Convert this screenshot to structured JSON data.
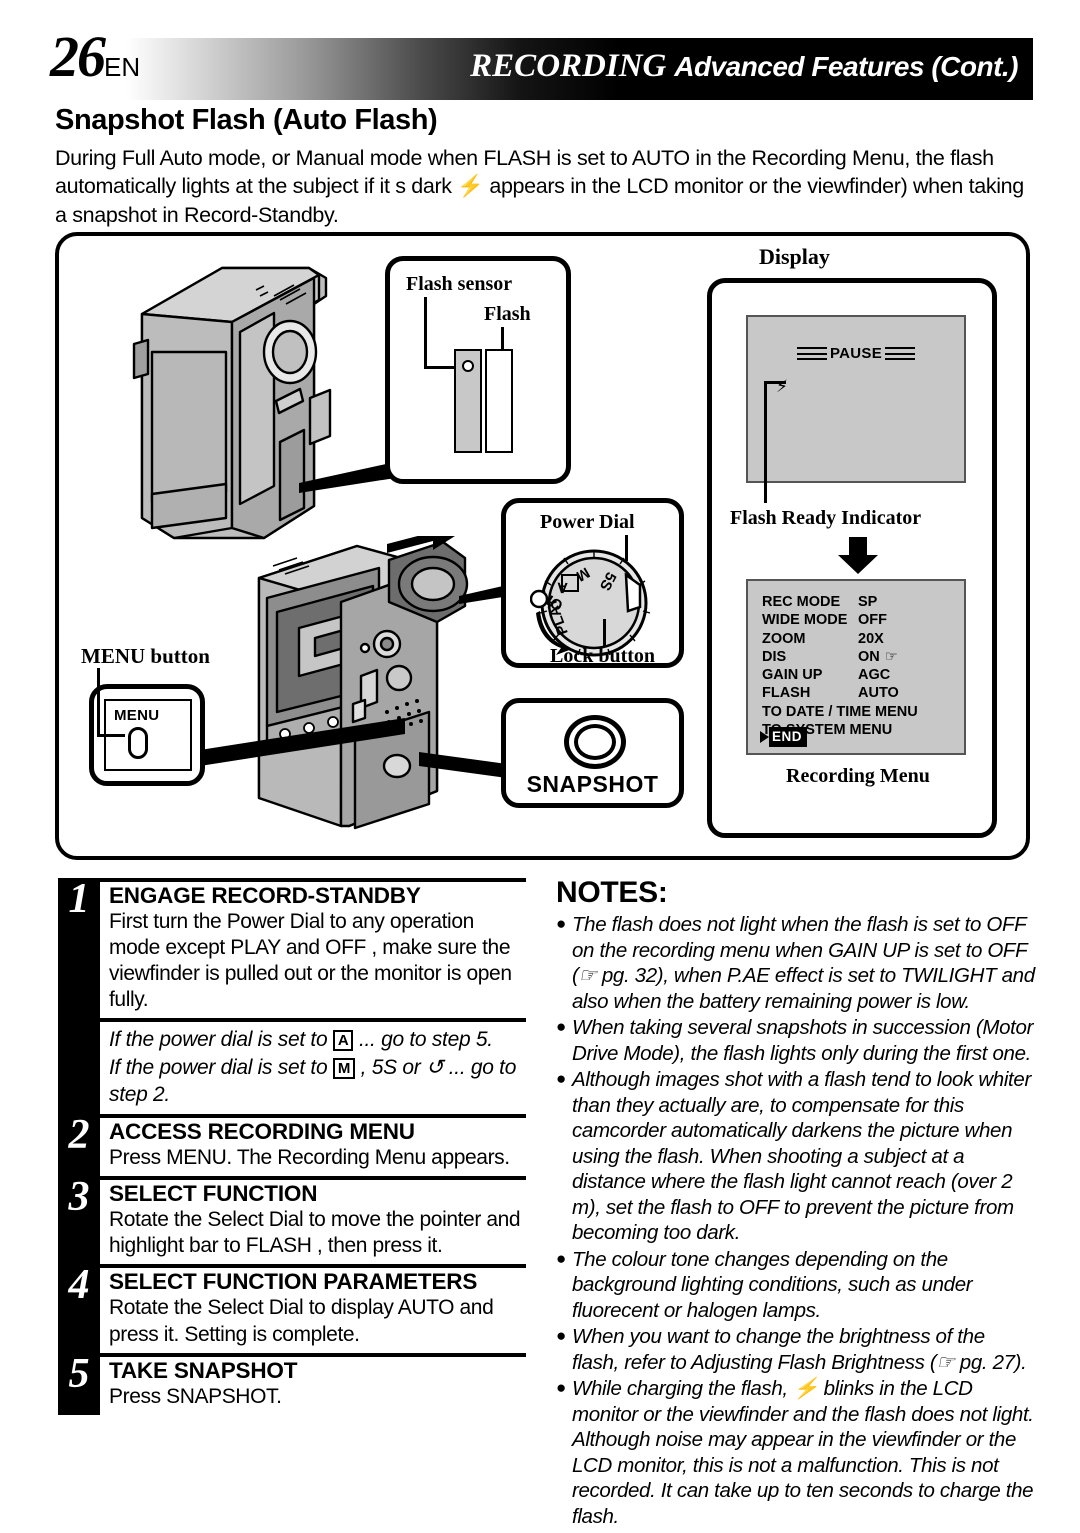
{
  "header": {
    "page_number": "26",
    "page_lang": "EN",
    "title_main": "RECORDING",
    "title_sub": "Advanced Features (Cont.)"
  },
  "section": {
    "title": "Snapshot Flash (Auto Flash)",
    "intro": "During Full Auto mode, or Manual mode when  FLASH  is set to  AUTO  in the Recording Menu, the flash automatically lights at the subject if it s dark  ⚡ appears in the LCD monitor or the viewfinder) when taking a snapshot in Record-Standby."
  },
  "diagram": {
    "flash_callout": {
      "sensor_label": "Flash sensor",
      "flash_label": "Flash"
    },
    "power_dial_callout": {
      "title": "Power Dial",
      "lock_label": "Lock button",
      "dial_positions": [
        "5S",
        "M",
        "A",
        "OFF",
        "PLAY"
      ]
    },
    "menu_callout": {
      "label": "MENU button",
      "button_text": "MENU"
    },
    "snapshot_callout": {
      "label": "SNAPSHOT"
    }
  },
  "display": {
    "title": "Display",
    "lcd": {
      "pause_text": "PAUSE",
      "flash_icon": "⚡",
      "indicator_label": "Flash Ready Indicator"
    },
    "recording_menu": {
      "caption": "Recording Menu",
      "rows": [
        {
          "key": "REC MODE",
          "value": "SP"
        },
        {
          "key": "WIDE MODE",
          "value": "OFF"
        },
        {
          "key": "ZOOM",
          "value": "20X"
        },
        {
          "key": "DIS",
          "value": "ON"
        },
        {
          "key": "GAIN UP",
          "value": "AGC"
        },
        {
          "key": "FLASH",
          "value": "AUTO"
        }
      ],
      "full_rows": [
        "TO DATE / TIME MENU",
        "TO SYSTEM MENU"
      ],
      "end_label": "END"
    }
  },
  "steps": [
    {
      "num": "1",
      "title": "ENGAGE RECORD-STANDBY",
      "text": "First turn the Power Dial to any operation mode except  PLAY  and  OFF , make sure the viewfinder is pulled out or the monitor is open fully."
    },
    {
      "num": "2",
      "title": "ACCESS RECORDING MENU",
      "text": "Press MENU. The Recording Menu appears."
    },
    {
      "num": "3",
      "title": "SELECT FUNCTION",
      "text": "Rotate the Select Dial to move the pointer and highlight bar to  FLASH , then press it."
    },
    {
      "num": "4",
      "title": "SELECT FUNCTION PARAMETERS",
      "text": "Rotate the Select Dial to display  AUTO  and press it. Setting is complete."
    },
    {
      "num": "5",
      "title": "TAKE SNAPSHOT",
      "text": "Press SNAPSHOT."
    }
  ],
  "step_subnotes": {
    "line1_pre": "If the power dial is set to ",
    "line1_icon": "A",
    "line1_post": " ... go to step 5.",
    "line2_pre": "If the power dial is set to ",
    "line2_icon": "M",
    "line2_post": " ,  5S  or  ↺ ... go to step 2."
  },
  "notes": {
    "heading": "NOTES:",
    "items": [
      "The flash does not light when the flash is set to  OFF  on the recording menu when GAIN UP is set to  OFF  (☞ pg. 32), when P.AE effect is set to  TWILIGHT  and also when the battery remaining power is low.",
      "When taking several snapshots in succession (Motor Drive Mode), the flash lights only during the first one.",
      "Although images shot with a flash tend to look whiter than they actually are, to compensate for this camcorder automatically darkens the picture when using the flash. When shooting a subject at a distance where the flash light cannot reach (over 2 m), set the flash to  OFF  to prevent the picture from becoming too dark.",
      "The colour tone changes depending on the background lighting conditions, such as under fluorecent or halogen lamps.",
      "When you want to change the brightness of the flash, refer to  Adjusting Flash Brightness  (☞ pg. 27).",
      "While charging the flash, ⚡ blinks in the LCD monitor or the viewfinder and the flash does not light. Although noise may appear in the viewfinder or the LCD monitor, this is not a malfunction. This is not recorded. It can take up to ten seconds to charge the flash."
    ]
  },
  "colors": {
    "lcd_gray": "#c8c8c8",
    "body_gray": "#b5b5b5",
    "accent_black": "#000000"
  }
}
